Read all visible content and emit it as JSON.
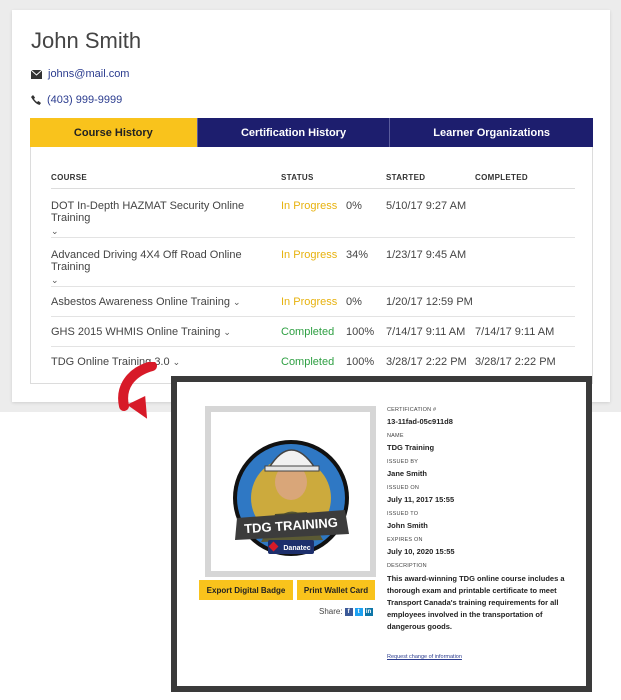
{
  "profile": {
    "name": "John Smith",
    "email": "johns@mail.com",
    "phone": "(403) 999-9999"
  },
  "tabs": [
    {
      "label": "Course History",
      "active": true
    },
    {
      "label": "Certification History",
      "active": false
    },
    {
      "label": "Learner Organizations",
      "active": false
    }
  ],
  "table": {
    "headers": [
      "COURSE",
      "STATUS",
      "",
      "STARTED",
      "COMPLETED"
    ],
    "rows": [
      {
        "course": "DOT In-Depth HAZMAT Security Online Training",
        "status": "In Progress",
        "percent": "0%",
        "started": "5/10/17 9:27 AM",
        "completed": ""
      },
      {
        "course": "Advanced Driving 4X4 Off Road Online Training",
        "status": "In Progress",
        "percent": "34%",
        "started": "1/23/17 9:45 AM",
        "completed": ""
      },
      {
        "course": "Asbestos Awareness Online Training",
        "status": "In Progress",
        "percent": "0%",
        "started": "1/20/17 12:59 PM",
        "completed": ""
      },
      {
        "course": "GHS 2015 WHMIS Online Training",
        "status": "Completed",
        "percent": "100%",
        "started": "7/14/17 9:11 AM",
        "completed": "7/14/17 9:11 AM"
      },
      {
        "course": "TDG Online Training 3.0",
        "status": "Completed",
        "percent": "100%",
        "started": "3/28/17 2:22 PM",
        "completed": "3/28/17 2:22 PM"
      }
    ]
  },
  "certificate": {
    "badge_banner": "TDG TRAINING",
    "badge_brand": "Danatec",
    "export_label": "Export Digital Badge",
    "wallet_label": "Print Wallet Card",
    "share_label": "Share:",
    "fields": [
      {
        "label": "CERTIFICATION #",
        "value": "13-11fad-05c911d8"
      },
      {
        "label": "NAME",
        "value": "TDG Training"
      },
      {
        "label": "ISSUED BY",
        "value": "Jane Smith"
      },
      {
        "label": "ISSUED ON",
        "value": "July 11, 2017 15:55"
      },
      {
        "label": "ISSUED TO",
        "value": "John Smith"
      },
      {
        "label": "EXPIRES ON",
        "value": "July 10, 2020 15:55"
      }
    ],
    "description_label": "DESCRIPTION",
    "description": "This award-winning TDG online course includes a thorough exam and printable certificate to meet Transport Canada's training requirements for all employees involved in the transportation of dangerous goods.",
    "request_link": "Request change of information"
  },
  "colors": {
    "accent_yellow": "#f9c31c",
    "navy": "#1d1e6e",
    "in_progress": "#e7b20e",
    "completed": "#2e9f42",
    "arrow_red": "#d71a28"
  }
}
